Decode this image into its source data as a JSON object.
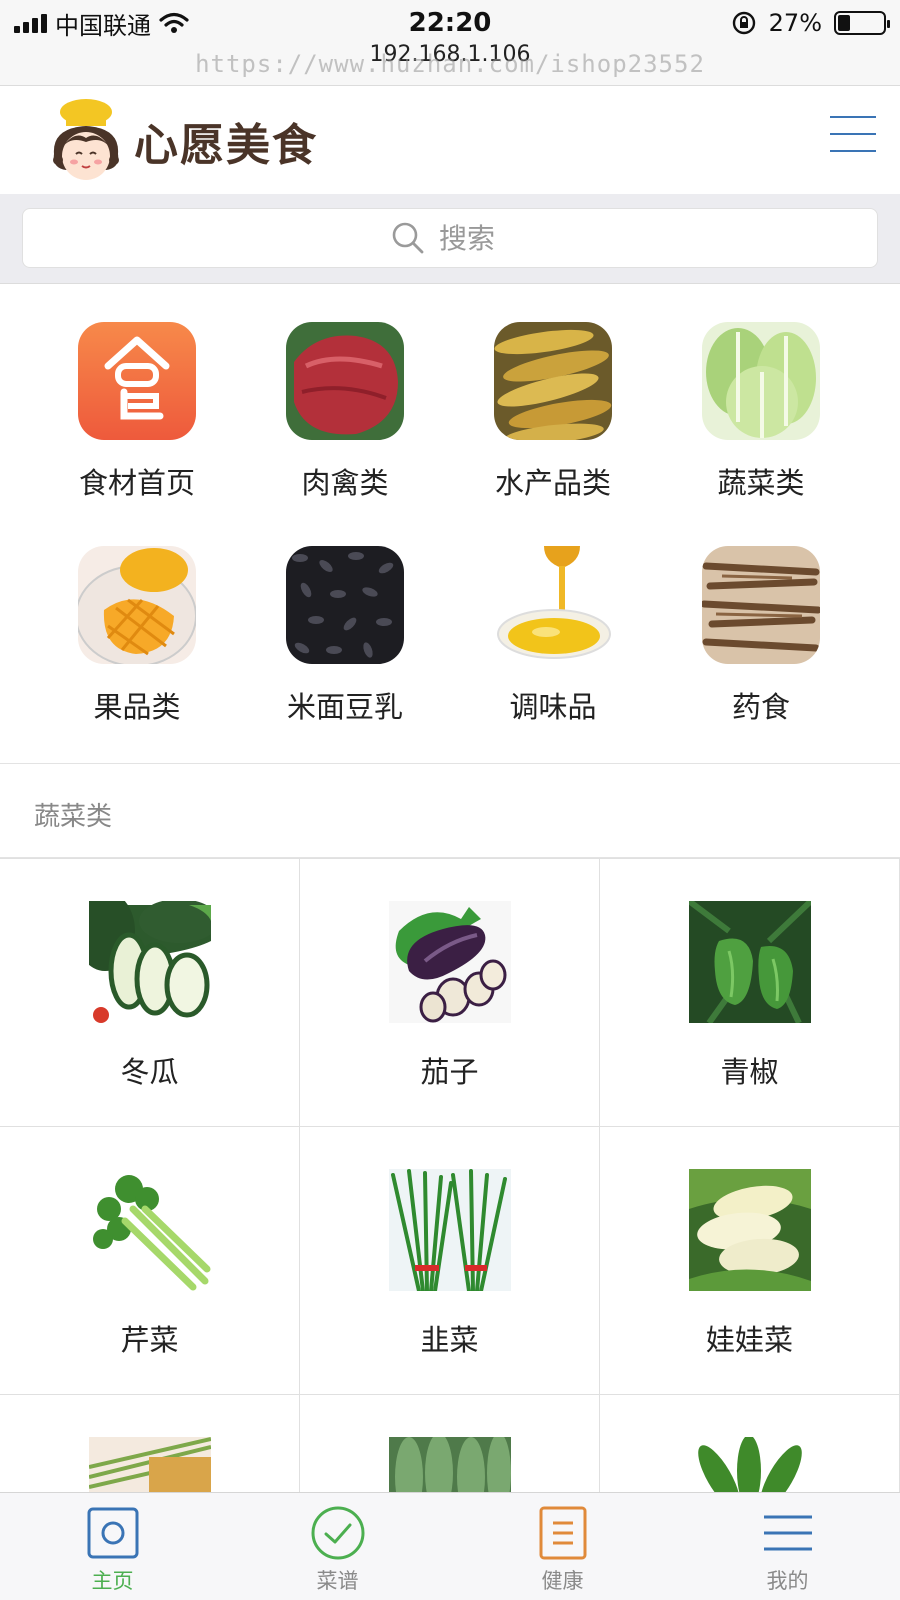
{
  "status_bar": {
    "carrier": "中国联通",
    "time": "22:20",
    "battery": "27%",
    "battery_level": 0.27,
    "url": "192.168.1.106",
    "watermark": "https://www.huzhan.com/ishop23552"
  },
  "header": {
    "logo_text": "心愿美食",
    "menu_icon": "hamburger-menu-icon"
  },
  "search": {
    "placeholder": "搜索",
    "icon": "search-icon"
  },
  "categories": [
    {
      "label": "食材首页",
      "icon": "food-home-icon"
    },
    {
      "label": "肉禽类",
      "icon": "meat-image"
    },
    {
      "label": "水产品类",
      "icon": "fish-image"
    },
    {
      "label": "蔬菜类",
      "icon": "cabbage-image"
    },
    {
      "label": "果品类",
      "icon": "mango-image"
    },
    {
      "label": "米面豆乳",
      "icon": "black-rice-image"
    },
    {
      "label": "调味品",
      "icon": "oil-image"
    },
    {
      "label": "药食",
      "icon": "herb-root-image"
    }
  ],
  "section": {
    "title": "蔬菜类"
  },
  "products": [
    {
      "name": "冬瓜",
      "image": "winter-melon-image"
    },
    {
      "name": "茄子",
      "image": "eggplant-image"
    },
    {
      "name": "青椒",
      "image": "green-pepper-image"
    },
    {
      "name": "芹菜",
      "image": "celery-image"
    },
    {
      "name": "韭菜",
      "image": "chives-image"
    },
    {
      "name": "娃娃菜",
      "image": "baby-cabbage-image"
    },
    {
      "name": "",
      "image": "vegetable-image"
    },
    {
      "name": "",
      "image": "vegetable-image"
    },
    {
      "name": "",
      "image": "vegetable-image"
    }
  ],
  "tabbar": {
    "tabs": [
      {
        "label": "主页",
        "icon": "home-icon",
        "active": true
      },
      {
        "label": "菜谱",
        "icon": "check-circle-icon",
        "active": false
      },
      {
        "label": "健康",
        "icon": "document-icon",
        "active": false
      },
      {
        "label": "我的",
        "icon": "menu-lines-icon",
        "active": false
      }
    ]
  },
  "colors": {
    "accent_green": "#4caf50",
    "menu_blue": "#3a74b5",
    "food_home_orange": "#f2774a"
  }
}
